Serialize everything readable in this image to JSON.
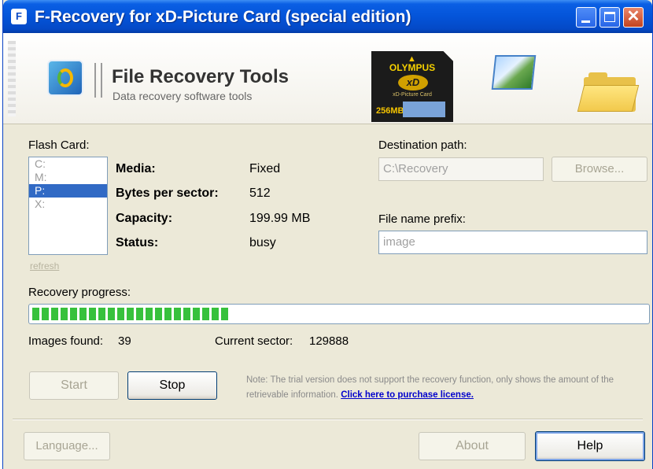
{
  "window": {
    "title": "F-Recovery for xD-Picture Card (special edition)",
    "title_icon": "app-icon",
    "controls": [
      "minimize",
      "maximize",
      "close"
    ],
    "close_glyph": "✕"
  },
  "banner": {
    "brand_title": "File Recovery Tools",
    "brand_subtitle": "Data recovery software tools",
    "card_brand": "OLYMPUS",
    "card_logo": "xD",
    "card_sub": "xD-Picture Card",
    "card_size": "256MB"
  },
  "flash_card": {
    "label": "Flash Card:",
    "drives": [
      "C:",
      "M:",
      "P:",
      "X:"
    ],
    "selected_drive": "P:",
    "refresh_label": "refresh"
  },
  "info": {
    "media_label": "Media:",
    "media_value": "Fixed",
    "bytes_label": "Bytes per sector:",
    "bytes_value": "512",
    "capacity_label": "Capacity:",
    "capacity_value": "199.99 MB",
    "status_label": "Status:",
    "status_value": "busy"
  },
  "destination": {
    "label": "Destination path:",
    "value": "C:\\Recovery",
    "browse_label": "Browse..."
  },
  "prefix": {
    "label": "File name prefix:",
    "value": "image"
  },
  "progress": {
    "label": "Recovery progress:",
    "fraction": 0.32
  },
  "stats": {
    "images_label": "Images found:",
    "images_value": "39",
    "sector_label": "Current sector:",
    "sector_value": "129888"
  },
  "actions": {
    "start_label": "Start",
    "stop_label": "Stop"
  },
  "note": {
    "text": "Note: The trial version does not support the recovery function, only shows the amount of the retrievable information.",
    "link_text": "Click here to purchase license."
  },
  "footer": {
    "language_label": "Language...",
    "about_label": "About",
    "help_label": "Help"
  },
  "colors": {
    "title_bar": "#0454d9",
    "progress_fill": "#37c13c",
    "selection": "#316ac5",
    "link": "#0000cc"
  }
}
